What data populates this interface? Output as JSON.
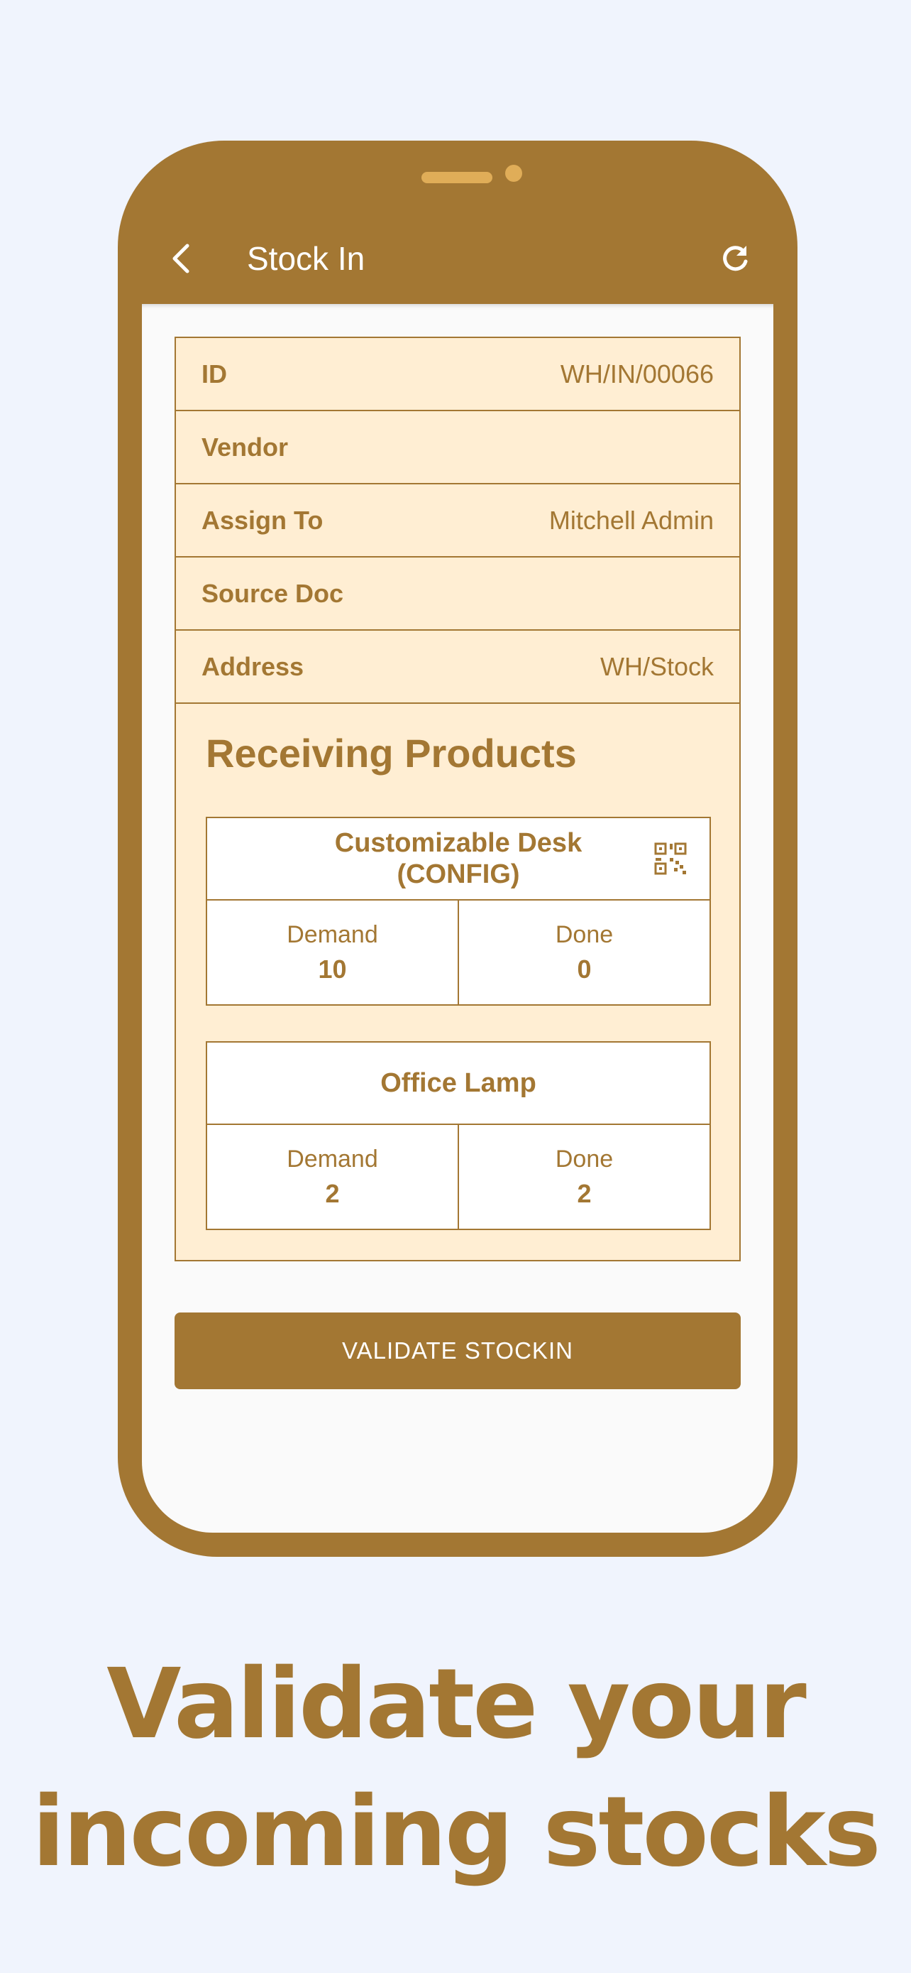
{
  "appbar": {
    "title": "Stock In",
    "back_icon": "chevron-left-icon",
    "refresh_icon": "refresh-icon"
  },
  "info": [
    {
      "label": "ID",
      "value": "WH/IN/00066"
    },
    {
      "label": "Vendor",
      "value": ""
    },
    {
      "label": "Assign To",
      "value": "Mitchell Admin"
    },
    {
      "label": "Source Doc",
      "value": ""
    },
    {
      "label": "Address",
      "value": "WH/Stock"
    }
  ],
  "section_title": "Receiving Products",
  "products": [
    {
      "name": "Customizable Desk (CONFIG)",
      "demand_label": "Demand",
      "demand": "10",
      "done_label": "Done",
      "done": "0",
      "has_qr": true
    },
    {
      "name": "Office Lamp",
      "demand_label": "Demand",
      "demand": "2",
      "done_label": "Done",
      "done": "2",
      "has_qr": false
    }
  ],
  "validate_button": "VALIDATE STOCKIN",
  "caption": {
    "line1": "Validate your",
    "line2": "incoming stocks"
  },
  "colors": {
    "brand": "#a37733",
    "card_bg": "#ffeed3",
    "page_bg": "#f0f4fd",
    "notch": "#e0ad58"
  }
}
